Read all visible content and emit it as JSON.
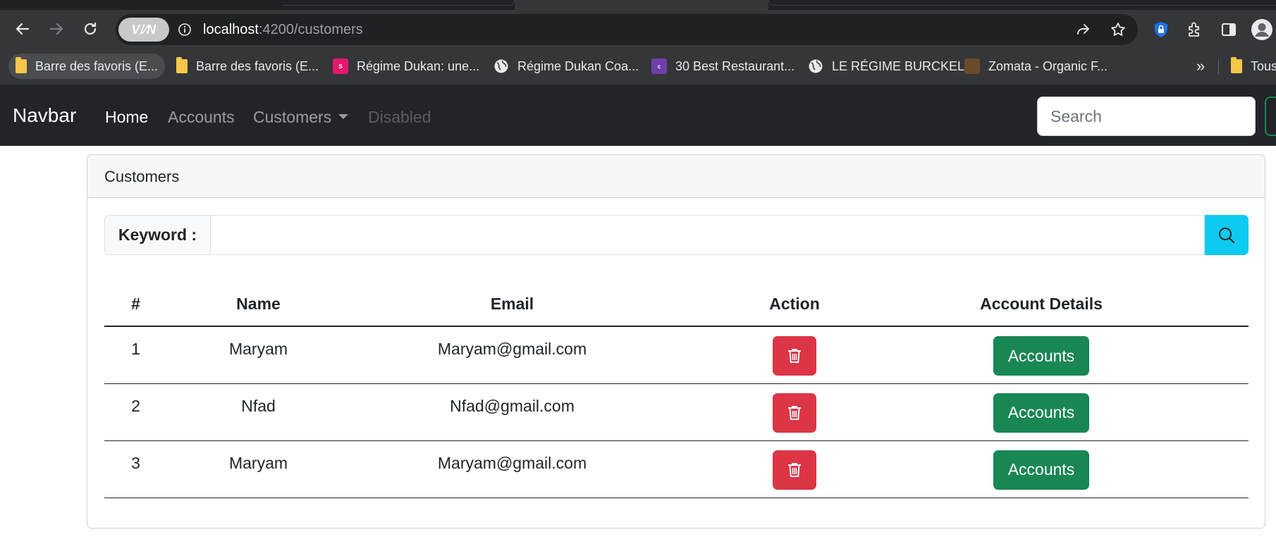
{
  "browser": {
    "url_host": "localhost",
    "url_path": ":4200/customers",
    "vpn_label": "V/⁄N",
    "bookmarks": [
      {
        "label": "Barre des favoris (E...",
        "icon": "folder-icon"
      },
      {
        "label": "Barre des favoris (E...",
        "icon": "folder-icon"
      },
      {
        "label": "Régime Dukan: une...",
        "icon": "sante-favicon"
      },
      {
        "label": "Régime Dukan Coa...",
        "icon": "globe-icon"
      },
      {
        "label": "30 Best Restaurant...",
        "icon": "colorlib-favicon"
      },
      {
        "label": "LE RÉGIME BURCKEL",
        "icon": "globe-icon"
      },
      {
        "label": "Zomata - Organic F...",
        "icon": "zomata-favicon"
      },
      {
        "label": "Tous",
        "icon": "folder-icon"
      }
    ],
    "bookmarks_more": "»",
    "colors": {
      "chrome_bg": "#35363a",
      "omnibox_bg": "#202124"
    }
  },
  "navbar": {
    "brand": "Navbar",
    "links": [
      "Home",
      "Accounts",
      "Customers",
      "Disabled"
    ],
    "search_placeholder": "Search",
    "colors": {
      "bg": "#212529"
    }
  },
  "card": {
    "title": "Customers",
    "keyword_label": "Keyword :",
    "keyword_value": "",
    "search_button_color": "#0dcaf0"
  },
  "table": {
    "headers": [
      "#",
      "Name",
      "Email",
      "Action",
      "Account Details"
    ],
    "rows": [
      {
        "id": "1",
        "name": "Maryam",
        "email": "Maryam@gmail.com",
        "button": "Accounts"
      },
      {
        "id": "2",
        "name": "Nfad",
        "email": "Nfad@gmail.com",
        "button": "Accounts"
      },
      {
        "id": "3",
        "name": "Maryam",
        "email": "Maryam@gmail.com",
        "button": "Accounts"
      }
    ],
    "colors": {
      "delete": "#dc3545",
      "accounts": "#198754"
    }
  }
}
